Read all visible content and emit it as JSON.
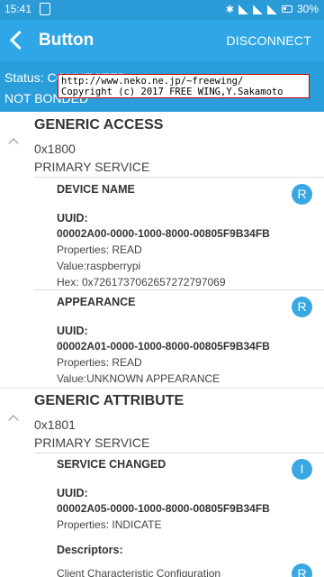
{
  "statusbar": {
    "time": "15:41",
    "battery": "30%"
  },
  "appbar": {
    "title": "Button",
    "disconnect_label": "DISCONNECT"
  },
  "connection": {
    "status": "Status: CONNECTED",
    "bond": "NOT BONDED"
  },
  "overlay": {
    "line1": "http://www.neko.ne.jp/~freewing/",
    "line2": "Copyright (c) 2017 FREE WING,Y.Sakamoto"
  },
  "services": [
    {
      "name": "GENERIC ACCESS",
      "uuid": "0x1800",
      "type": "PRIMARY SERVICE",
      "characteristics": [
        {
          "name": "DEVICE NAME",
          "uuid_label": "UUID:",
          "uuid": "00002A00-0000-1000-8000-00805F9B34FB",
          "properties": "Properties: READ",
          "value": "Value:raspberrypi",
          "hex": "Hex: 0x7261737062657272797069",
          "badge": "R"
        },
        {
          "name": "APPEARANCE",
          "uuid_label": "UUID:",
          "uuid": "00002A01-0000-1000-8000-00805F9B34FB",
          "properties": "Properties: READ",
          "value": "Value:UNKNOWN APPEARANCE",
          "badge": "R"
        }
      ]
    },
    {
      "name": "GENERIC ATTRIBUTE",
      "uuid": "0x1801",
      "type": "PRIMARY SERVICE",
      "characteristics": [
        {
          "name": "SERVICE CHANGED",
          "uuid_label": "UUID:",
          "uuid": "00002A05-0000-1000-8000-00805F9B34FB",
          "properties": "Properties: INDICATE",
          "descriptors_label": "Descriptors:",
          "descriptor": "Client Characteristic Configuration",
          "badge": "I",
          "descriptor_badge": "R"
        }
      ]
    }
  ]
}
